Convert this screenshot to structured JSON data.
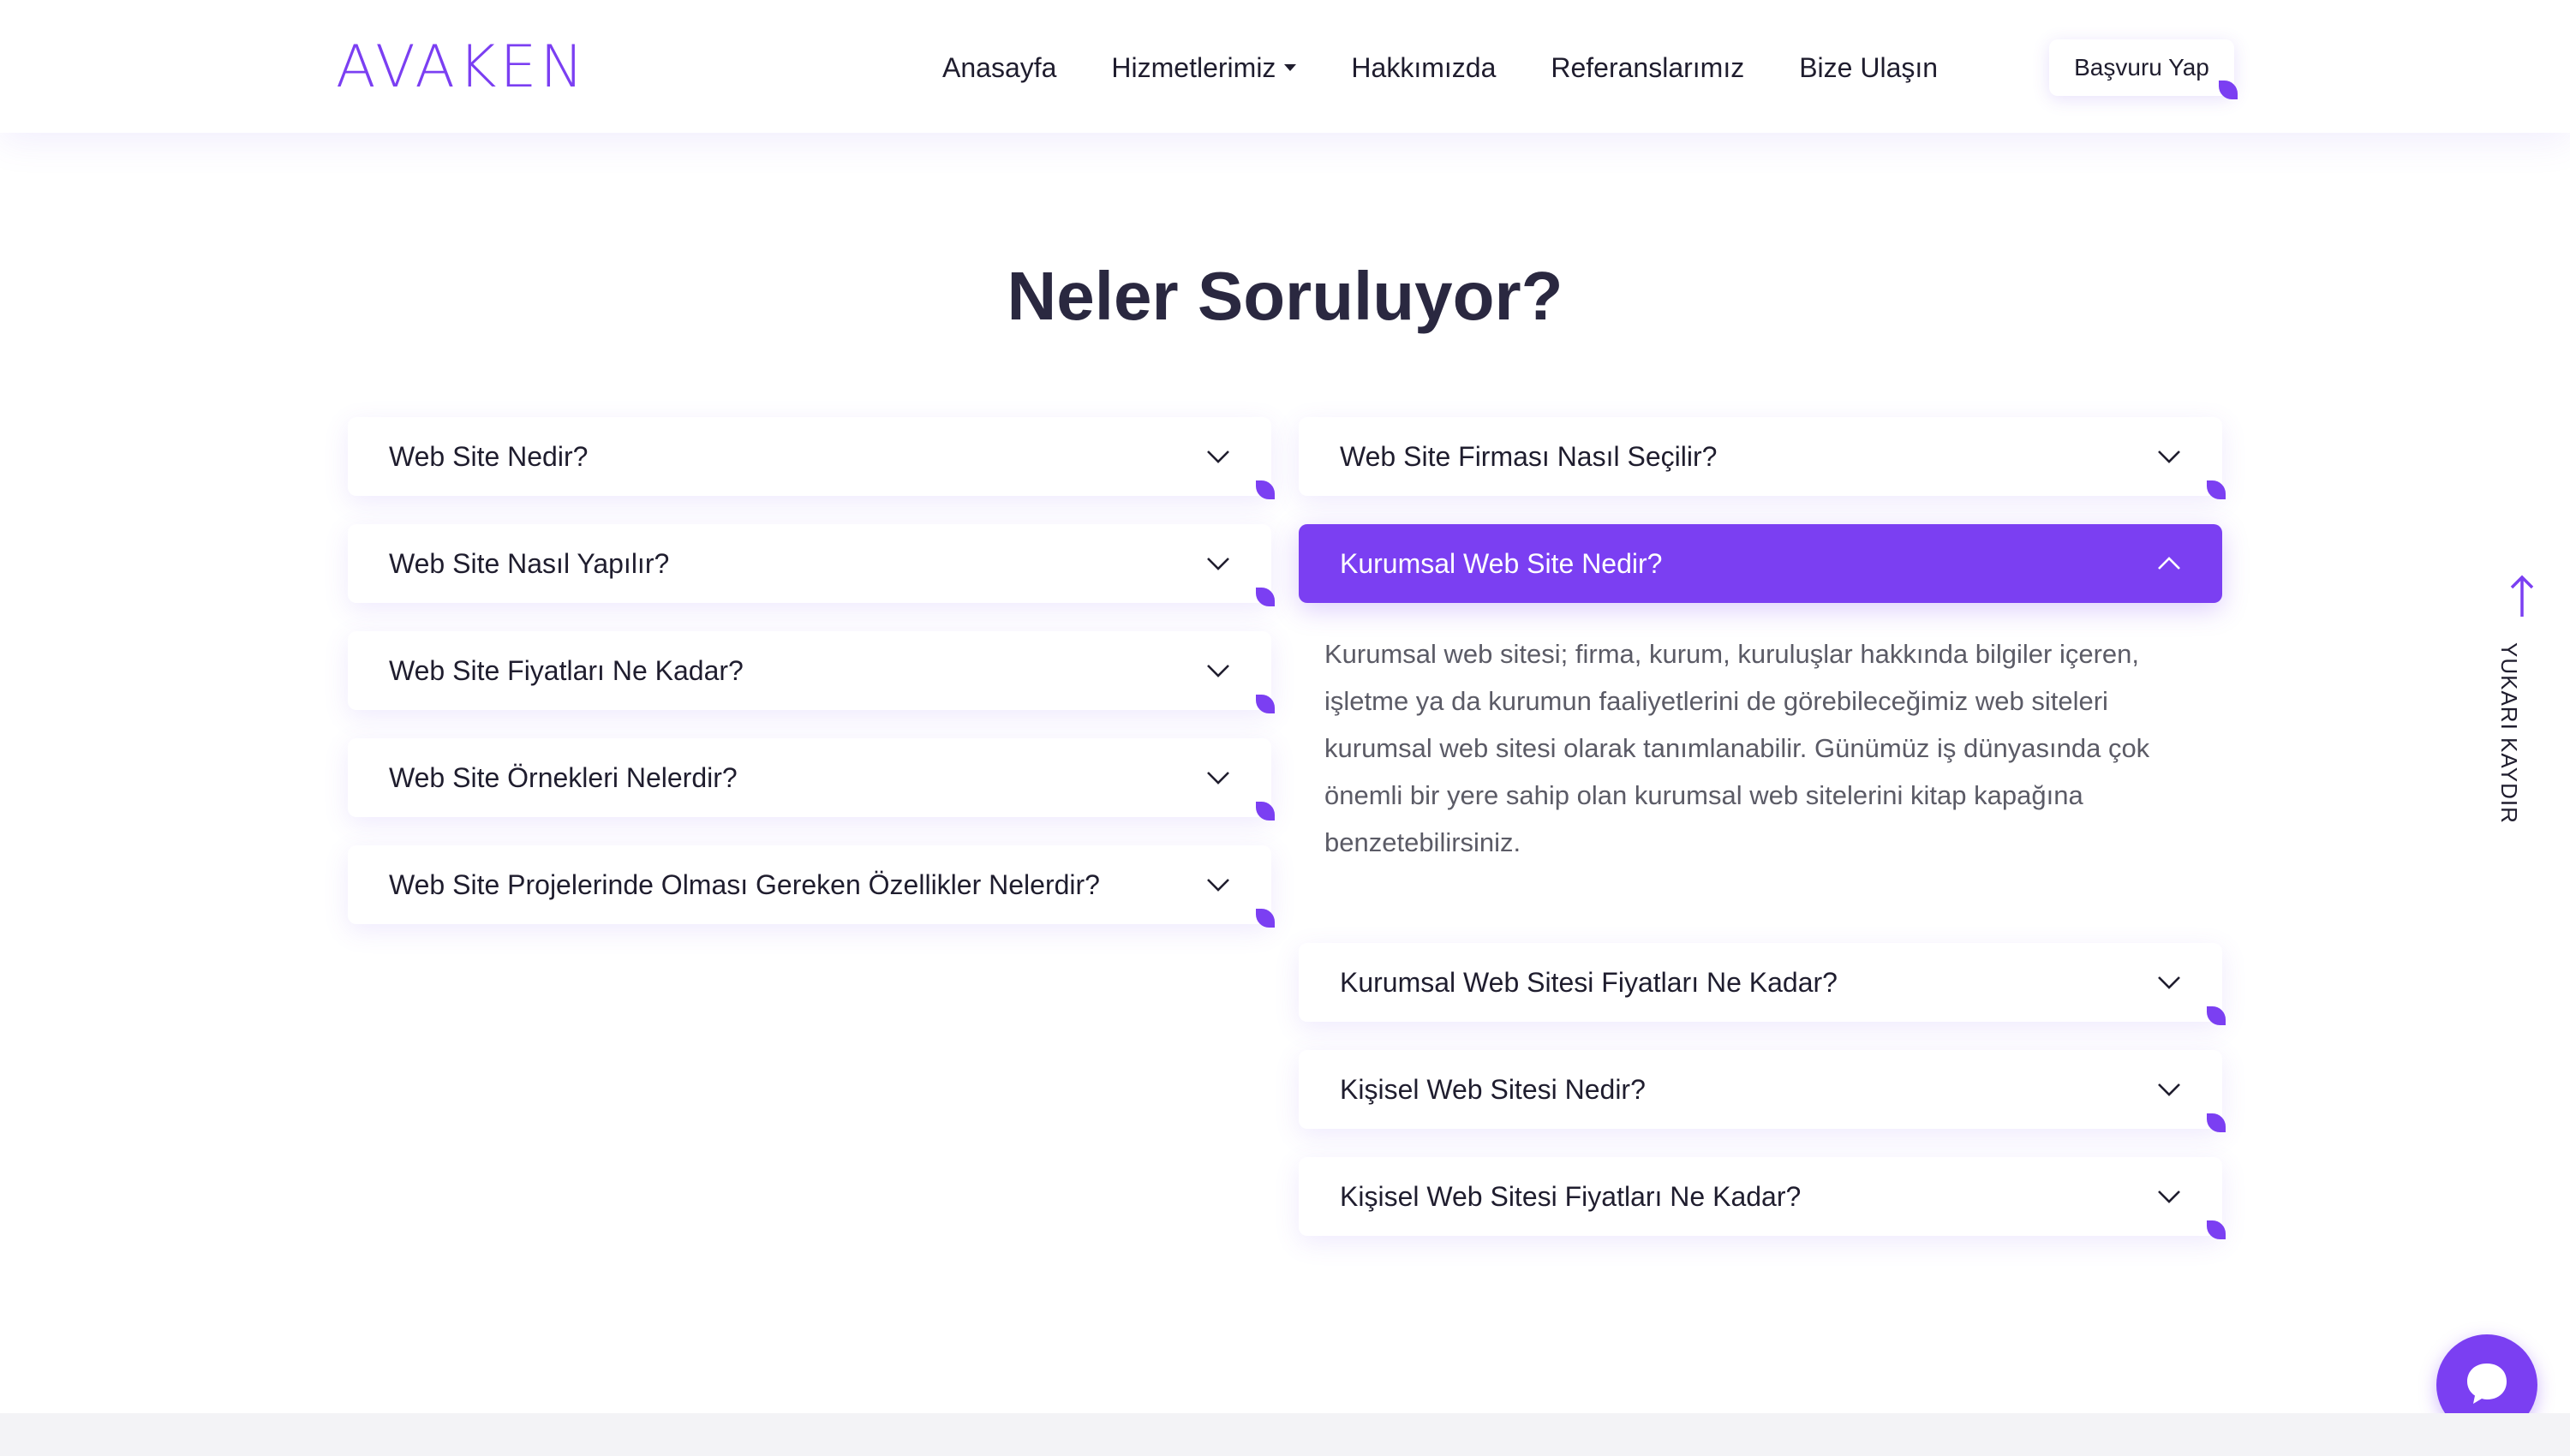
{
  "brand": {
    "logo_text": "AVAKEN",
    "accent": "#7b3ff2"
  },
  "nav": {
    "items": [
      {
        "label": "Anasayfa",
        "dropdown": false
      },
      {
        "label": "Hizmetlerimiz",
        "dropdown": true
      },
      {
        "label": "Hakkımızda",
        "dropdown": false
      },
      {
        "label": "Referanslarımız",
        "dropdown": false
      },
      {
        "label": "Bize Ulaşın",
        "dropdown": false
      }
    ],
    "cta_label": "Başvuru Yap"
  },
  "faq": {
    "title": "Neler Soruluyor?",
    "left": [
      "Web Site Nedir?",
      "Web Site Nasıl Yapılır?",
      "Web Site Fiyatları Ne Kadar?",
      "Web Site Örnekleri Nelerdir?",
      "Web Site Projelerinde Olması Gereken Özellikler Nelerdir?"
    ],
    "right": [
      "Web Site Firması Nasıl Seçilir?",
      "Kurumsal Web Site Nedir?",
      "Kurumsal Web Sitesi Fiyatları Ne Kadar?",
      "Kişisel Web Sitesi Nedir?",
      "Kişisel Web Sitesi Fiyatları Ne Kadar?"
    ],
    "open_item": "Kurumsal Web Site Nedir?",
    "open_answer": "Kurumsal web sitesi; firma, kurum, kuruluşlar hakkında bilgiler içeren, işletme ya da kurumun faaliyetlerini de görebileceğimiz web siteleri kurumsal web sitesi olarak tanımlanabilir. Günümüz iş dünyasında çok önemli bir yere sahip olan kurumsal web sitelerini kitap kapağına benzetebilirsiniz."
  },
  "scroll_top": {
    "label": "YUKARI KAYDIR",
    "icon": "arrow-up-icon"
  },
  "chat": {
    "icon": "chat-bubble-icon"
  }
}
